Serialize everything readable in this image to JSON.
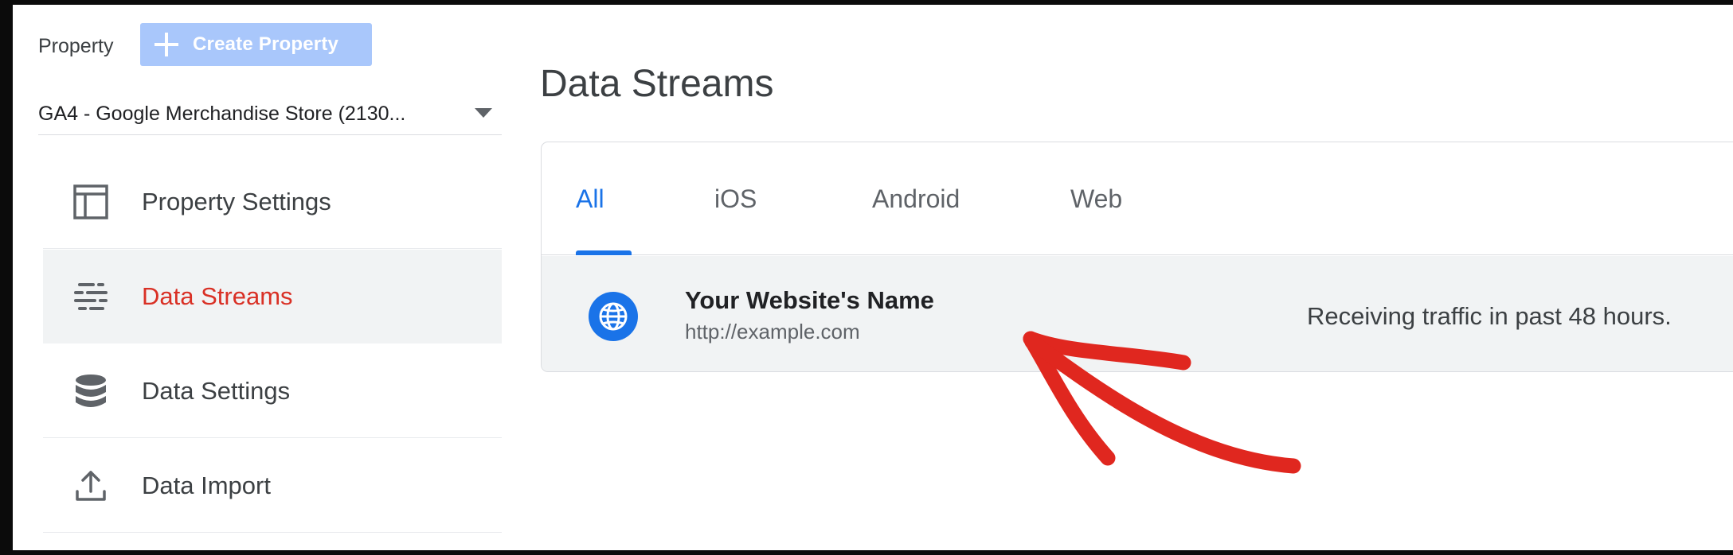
{
  "sidebar": {
    "property_label": "Property",
    "create_button_label": "Create Property",
    "selected_property": "GA4 - Google Merchandise Store (2130...",
    "items": [
      {
        "label": "Property Settings",
        "icon": "layout-icon",
        "active": false
      },
      {
        "label": "Data Streams",
        "icon": "data-streams-icon",
        "active": true
      },
      {
        "label": "Data Settings",
        "icon": "database-icon",
        "active": false
      },
      {
        "label": "Data Import",
        "icon": "upload-icon",
        "active": false
      }
    ]
  },
  "main": {
    "title": "Data Streams",
    "tabs": [
      {
        "label": "All",
        "active": true
      },
      {
        "label": "iOS",
        "active": false
      },
      {
        "label": "Android",
        "active": false
      },
      {
        "label": "Web",
        "active": false
      }
    ],
    "stream": {
      "name": "Your Website's Name",
      "url": "http://example.com",
      "status": "Receiving traffic in past 48 hours.",
      "icon": "globe-icon"
    }
  },
  "annotation": {
    "type": "arrow",
    "color": "#e0271f"
  },
  "colors": {
    "accent_blue": "#1a73e8",
    "active_nav_red": "#d93025",
    "create_button_bg": "#a9c7fb"
  }
}
